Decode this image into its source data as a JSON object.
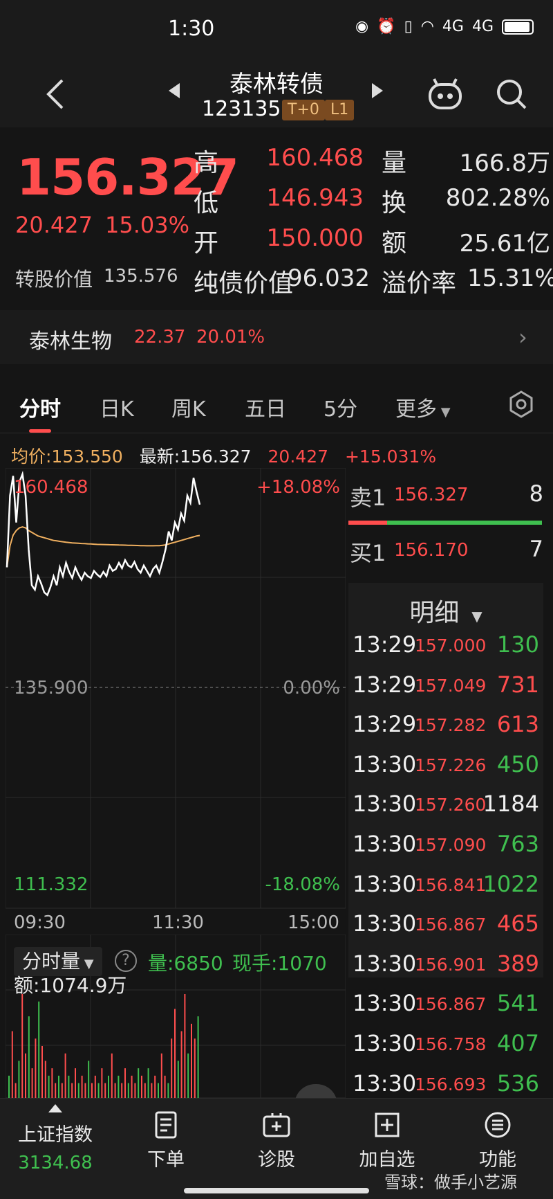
{
  "status": {
    "time": "1:30",
    "signal_1": "4G",
    "signal_2": "4G"
  },
  "header": {
    "name": "泰林转债",
    "code": "123135",
    "tag_t0": "T+0",
    "tag_l1": "L1"
  },
  "quote": {
    "price": "156.327",
    "change": "20.427",
    "change_pct": "15.03%",
    "conv_label": "转股价值",
    "conv_value": "135.576",
    "high_label": "高",
    "high": "160.468",
    "low_label": "低",
    "low": "146.943",
    "open_label": "开",
    "open": "150.000",
    "bond_label": "纯债价值",
    "bond_value": "96.032",
    "vol_label": "量",
    "vol": "166.8万",
    "turn_label": "换",
    "turn": "802.28%",
    "amt_label": "额",
    "amt": "25.61亿",
    "prem_label": "溢价率",
    "prem": "15.31%"
  },
  "related": {
    "name": "泰林生物",
    "price": "22.37",
    "pct": "20.01%"
  },
  "tabs": [
    "分时",
    "日K",
    "周K",
    "五日",
    "5分",
    "更多"
  ],
  "info": {
    "avg": "均价:153.550",
    "latest": "最新:156.327",
    "chg": "20.427",
    "pct": "+15.031%"
  },
  "chart": {
    "y_top": "160.468",
    "y_mid": "135.900",
    "y_bot": "111.332",
    "pct_top": "+18.08%",
    "pct_mid": "0.00%",
    "pct_bot": "-18.08%",
    "x_start": "09:30",
    "x_mid": "11:30",
    "x_end": "15:00",
    "price_line": [
      150,
      158,
      160.2,
      155,
      159.5,
      160.4,
      158,
      152,
      148,
      147.5,
      149,
      148.2,
      147.2,
      146.9,
      147.8,
      149,
      148,
      150,
      149,
      150.5,
      149.5,
      148.8,
      150,
      149.2,
      148.6,
      149.4,
      149,
      148.8,
      149.6,
      149.2,
      148.9,
      149.5,
      149,
      150.2,
      149.6,
      149.8,
      150.5,
      149.9,
      150.8,
      150.2,
      150,
      150.6,
      149.8,
      149.4,
      150.2,
      149.6,
      149,
      149.8,
      150.2,
      149.4,
      150.6,
      152,
      154,
      153,
      155,
      154.2,
      156,
      155.2,
      158,
      157.2,
      160,
      158.4,
      157
    ],
    "avg_line": [
      150,
      152.4,
      153.6,
      154.1,
      154.4,
      154.5,
      154.4,
      154.1,
      153.9,
      153.7,
      153.5,
      153.4,
      153.3,
      153.2,
      153.1,
      153.0,
      152.95,
      152.9,
      152.85,
      152.8,
      152.76,
      152.72,
      152.7,
      152.68,
      152.66,
      152.64,
      152.62,
      152.6,
      152.58,
      152.56,
      152.55,
      152.54,
      152.53,
      152.52,
      152.51,
      152.5,
      152.49,
      152.48,
      152.47,
      152.46,
      152.45,
      152.44,
      152.43,
      152.42,
      152.41,
      152.4,
      152.4,
      152.4,
      152.41,
      152.42,
      152.45,
      152.5,
      152.6,
      152.7,
      152.8,
      152.9,
      153.0,
      153.1,
      153.2,
      153.3,
      153.4,
      153.5,
      153.55
    ]
  },
  "orderbook": {
    "ask_label": "卖1",
    "ask_price": "156.327",
    "ask_vol": "8",
    "bid_label": "买1",
    "bid_price": "156.170",
    "bid_vol": "7"
  },
  "detail": {
    "title": "明细",
    "rows": [
      {
        "time": "13:29",
        "price": "157.000",
        "vol": "130",
        "dir": "buy"
      },
      {
        "time": "13:29",
        "price": "157.049",
        "vol": "731",
        "dir": "sell"
      },
      {
        "time": "13:29",
        "price": "157.282",
        "vol": "613",
        "dir": "sell"
      },
      {
        "time": "13:30",
        "price": "157.226",
        "vol": "450",
        "dir": "buy"
      },
      {
        "time": "13:30",
        "price": "157.260",
        "vol": "1184",
        "dir": "neutral"
      },
      {
        "time": "13:30",
        "price": "157.090",
        "vol": "763",
        "dir": "buy"
      },
      {
        "time": "13:30",
        "price": "156.841",
        "vol": "1022",
        "dir": "buy"
      },
      {
        "time": "13:30",
        "price": "156.867",
        "vol": "465",
        "dir": "sell"
      },
      {
        "time": "13:30",
        "price": "156.901",
        "vol": "389",
        "dir": "sell"
      },
      {
        "time": "13:30",
        "price": "156.867",
        "vol": "541",
        "dir": "buy"
      },
      {
        "time": "13:30",
        "price": "156.758",
        "vol": "407",
        "dir": "buy"
      },
      {
        "time": "13:30",
        "price": "156.693",
        "vol": "536",
        "dir": "buy"
      }
    ]
  },
  "volume": {
    "selector": "分时量",
    "help": "?",
    "qty": "量:6850",
    "cur": "现手:1070",
    "amt": "额:1074.9万",
    "bars": [
      3,
      9,
      2,
      5,
      14,
      6,
      11,
      4,
      8,
      13,
      7,
      5,
      3,
      4,
      2,
      3,
      2,
      6,
      3,
      2,
      4,
      2,
      3,
      2,
      5,
      2,
      3,
      2,
      4,
      2,
      3,
      6,
      2,
      3,
      2,
      4,
      2,
      3,
      2,
      4,
      3,
      2,
      4,
      2,
      3,
      2,
      6,
      3,
      2,
      8,
      12,
      5,
      9,
      14,
      6,
      10,
      8,
      11
    ]
  },
  "bottom_nav": {
    "index_name": "上证指数",
    "index_value": "3134.68",
    "order": "下单",
    "diagnose": "诊股",
    "add_watch": "加自选",
    "functions": "功能"
  },
  "watermark": "雪球：做手小艺源",
  "colors": {
    "up": "#ff4d4d",
    "down": "#3fbf4f",
    "avg_line": "#f0b060",
    "price_line": "#ffffff",
    "background": "#151515"
  }
}
